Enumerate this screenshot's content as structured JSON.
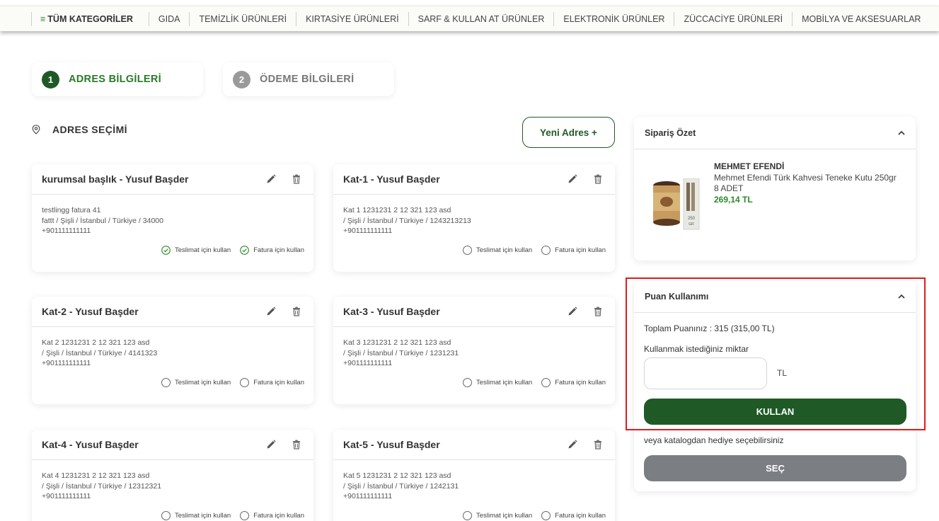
{
  "nav": {
    "all_categories": "TÜM KATEGORİLER",
    "items": [
      "GIDA",
      "TEMİZLİK ÜRÜNLERİ",
      "KIRTASİYE ÜRÜNLERİ",
      "SARF & KULLAN AT ÜRÜNLER",
      "ELEKTRONİK ÜRÜNLER",
      "ZÜCCACİYE ÜRÜNLERİ",
      "MOBİLYA VE AKSESUARLAR"
    ]
  },
  "steps": [
    {
      "num": "1",
      "label": "ADRES BİLGİLERİ",
      "active": true
    },
    {
      "num": "2",
      "label": "ÖDEME BİLGİLERİ",
      "active": false
    }
  ],
  "address_section": {
    "title": "ADRES SEÇİMİ",
    "new_address_button": "Yeni Adres +"
  },
  "options": {
    "delivery": "Teslimat için kullan",
    "billing": "Fatura için kullan"
  },
  "addresses": [
    {
      "title": "kurumsal başlık - Yusuf Başder",
      "line1": "testlingg fatura 41",
      "line2": "fattt / Şişli / İstanbul / Türkiye / 34000",
      "phone": "+901111111111",
      "delivery_selected": true,
      "billing_selected": true
    },
    {
      "title": "Kat-1 - Yusuf Başder",
      "line1": "Kat 1 1231231 2 12 321 123 asd",
      "line2": "/ Şişli / İstanbul / Türkiye / 1243213213",
      "phone": "+901111111111",
      "delivery_selected": false,
      "billing_selected": false
    },
    {
      "title": "Kat-2 - Yusuf Başder",
      "line1": "Kat 2 1231231 2 12 321 123 asd",
      "line2": "/ Şişli / İstanbul / Türkiye / 4141323",
      "phone": "+901111111111",
      "delivery_selected": false,
      "billing_selected": false
    },
    {
      "title": "Kat-3 - Yusuf Başder",
      "line1": "Kat 3 1231231 2 12 321 123 asd",
      "line2": "/ Şişli / İstanbul / Türkiye / 1231231",
      "phone": "+901111111111",
      "delivery_selected": false,
      "billing_selected": false
    },
    {
      "title": "Kat-4 - Yusuf Başder",
      "line1": "Kat 4 1231231 2 12 321 123 asd",
      "line2": "/ Şişli / İstanbul / Türkiye / 12312321",
      "phone": "+901111111111",
      "delivery_selected": false,
      "billing_selected": false
    },
    {
      "title": "Kat-5 - Yusuf Başder",
      "line1": "Kat 5 1231231 2 12 321 123 asd",
      "line2": "/ Şişli / İstanbul / Türkiye / 1242131",
      "phone": "+901111111111",
      "delivery_selected": false,
      "billing_selected": false
    }
  ],
  "order_summary": {
    "title": "Sipariş Özet",
    "product": {
      "brand": "MEHMET EFENDİ",
      "name": "Mehmet Efendi Türk Kahvesi Teneke Kutu 250gr",
      "quantity": "8 ADET",
      "price": "269,14 TL"
    }
  },
  "points": {
    "title": "Puan Kullanımı",
    "total": "Toplam Puanınız : 315 (315,00 TL)",
    "amount_label": "Kullanmak istediğiniz miktar",
    "amount_value": "",
    "currency": "TL",
    "use_button": "KULLAN",
    "catalog_text": "veya katalogdan hediye seçebilirsiniz",
    "select_button": "SEÇ"
  },
  "colors": {
    "primary_green": "#1f5a26",
    "accent_green": "#2a7a2a",
    "price_green": "#2a8a2a",
    "gray_button": "#7b7f84",
    "highlight_red": "#e01b1b"
  }
}
